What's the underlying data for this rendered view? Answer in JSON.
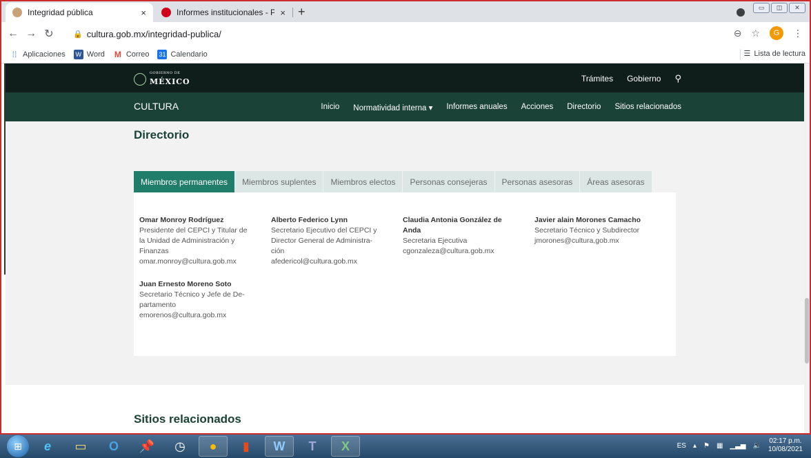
{
  "browser": {
    "tabs": [
      {
        "title": "Integridad pública",
        "favicon_color": "#c8a37a",
        "active": true
      },
      {
        "title": "Informes institucionales - Pronun",
        "favicon_color": "#d0021b",
        "active": false
      }
    ],
    "new_tab_glyph": "+",
    "close_glyph": "×",
    "url": "cultura.gob.mx/integridad-publica/",
    "avatar_letter": "G",
    "bookmarks": [
      {
        "label": "Aplicaciones",
        "icon": "apps-grid-icon",
        "color": "#4285f4"
      },
      {
        "label": "Word",
        "icon": "word-icon",
        "color": "#2b579a"
      },
      {
        "label": "Correo",
        "icon": "gmail-icon",
        "color": "#ea4335"
      },
      {
        "label": "Calendario",
        "icon": "calendar-icon",
        "color": "#1a73e8"
      }
    ],
    "reading_list": "Lista de lectura"
  },
  "site": {
    "gob_small": "GOBIERNO DE",
    "gob_big": "MÉXICO",
    "top_links": [
      "Trámites",
      "Gobierno"
    ],
    "brand": "CULTURA",
    "nav": [
      "Inicio",
      "Normatividad interna ▾",
      "Informes anuales",
      "Acciones",
      "Directorio",
      "Sitios relacionados"
    ],
    "section_title": "Directorio",
    "tabs": [
      "Miembros permanentes",
      "Miembros suplentes",
      "Miembros electos",
      "Personas consejeras",
      "Personas asesoras",
      "Áreas asesoras"
    ],
    "members": [
      {
        "name": "Omar Monroy Rodríguez",
        "lines": [
          "Presidente del CEPCI y Titular de",
          "la Unidad de Administración y",
          "Finanzas",
          "omar.monroy@cultura.gob.mx"
        ]
      },
      {
        "name": "Alberto Federico Lynn",
        "lines": [
          "Secretario Ejecutivo del CEPCI y",
          "Director General de Administra-",
          "ción",
          "afedericol@cultura.gob.mx"
        ]
      },
      {
        "name": "Claudia Antonia González de Anda",
        "lines": [
          "Secretaria Ejecutiva",
          "cgonzaleza@cultura.gob.mx"
        ]
      },
      {
        "name": "Javier alain Morones Camacho",
        "lines": [
          "Secretario Técnico y Subdirector",
          "jmorones@cultura,gob.mx"
        ]
      },
      {
        "name": "Juan Ernesto Moreno Soto",
        "lines": [
          "Secretario Técnico y Jefe de De-",
          "partamento",
          "emorenos@cultura.gob.mx"
        ]
      }
    ],
    "next_section": "Sitios relacionados"
  },
  "taskbar": {
    "lang": "ES",
    "time": "02:17 p.m.",
    "date": "10/08/2021"
  }
}
